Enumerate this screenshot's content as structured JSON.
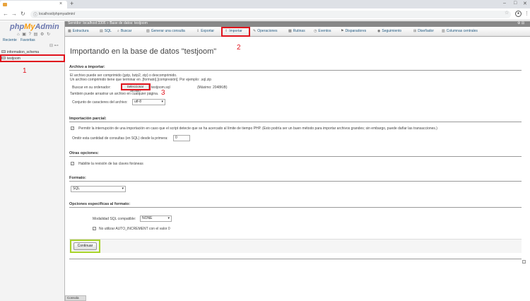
{
  "browser": {
    "tab_title": "...",
    "new_tab": "+",
    "url": "localhost/phpmyadmin/",
    "min": "–",
    "max": "□",
    "close": "✕"
  },
  "sidebar": {
    "logo_php": "php",
    "logo_my": "My",
    "logo_admin": "Admin",
    "links": [
      "Reciente",
      "Favoritas"
    ],
    "databases": [
      "information_schema",
      "testjoom"
    ]
  },
  "breadcrumb": {
    "server": "Servidor: localhost:3306",
    "database": "Base de datos: testjoom"
  },
  "tabs": [
    "Estructura",
    "SQL",
    "Buscar",
    "Generar una consulta",
    "Exportar",
    "Importar",
    "Operaciones",
    "Rutinas",
    "Eventos",
    "Disparadores",
    "Seguimiento",
    "Diseñador",
    "Columnas centrales"
  ],
  "annotations": {
    "one": "1",
    "two": "2",
    "three": "3"
  },
  "page": {
    "title": "Importando en la base de datos \"testjoom\"",
    "file_section": "Archivo a importar:",
    "file_desc1": "El archivo puede ser comprimido (gzip, bzip2, zip) o descomprimido.",
    "file_desc2": "Un archivo comprimido tiene que terminar en .[formato].[compresión]. Por ejemplo: .sql.zip",
    "browse_label": "Buscar en su ordenador:",
    "select_file_button": "Seleccionar archivo",
    "file_chosen": "testjoom.sql",
    "max_size": "(Máximo: 2048KiB)",
    "drag_hint": "También puede arrastrar un archivo en cualquier página.",
    "charset_label": "Conjunto de caracteres del archivo:",
    "charset_value": "utf-8",
    "partial_section": "Importación parcial:",
    "partial_interrupt": "Permitir la interrupción de una importación en caso que el script detecte que se ha acercado al límite de tiempo PHP. (Esto podría ser un buen método para importar archivos grandes; sin embargo, puede dañar las transacciones.)",
    "skip_label": "Omitir esta cantidad de consultas (en SQL) desde la primera:",
    "skip_value": "0",
    "other_section": "Otras opciones:",
    "foreign_keys": "Habilite la revisión de las claves foráneas",
    "format_section": "Formato:",
    "format_value": "SQL",
    "specific_section": "Opciones específicas al formato:",
    "sql_compat_label": "Modalidad SQL compatible:",
    "sql_compat_value": "NONE",
    "auto_increment": "No utilizar AUTO_INCREMENT con el valor 0",
    "continue_button": "Continuar",
    "console": "Consola"
  }
}
